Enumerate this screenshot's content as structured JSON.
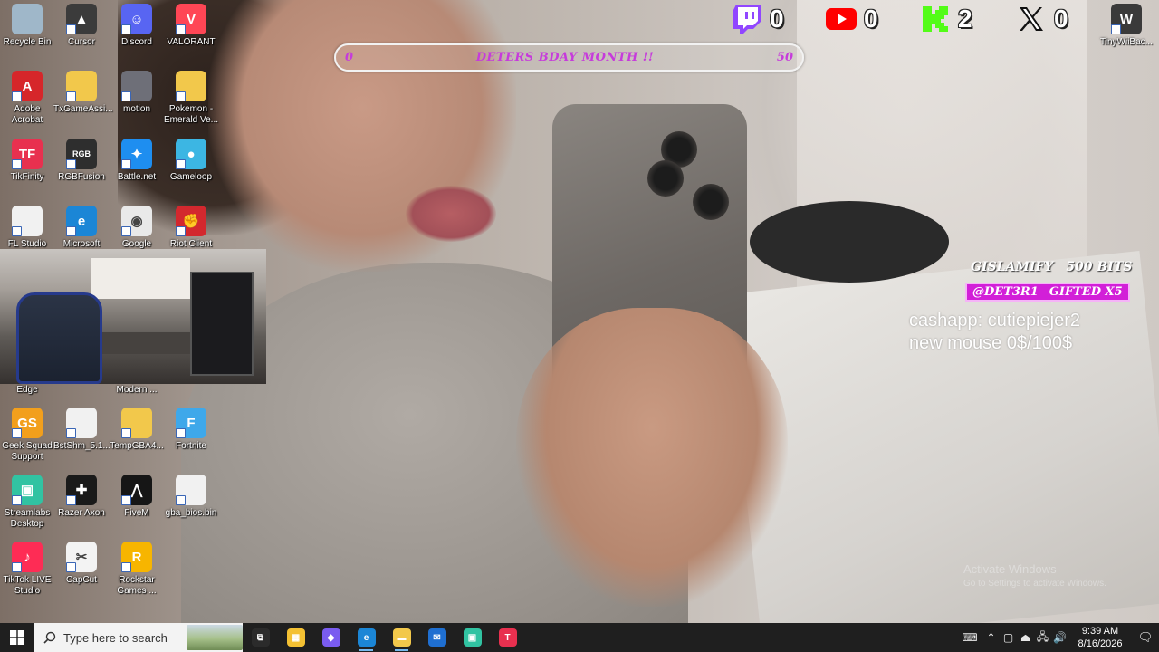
{
  "desktop_icons": [
    {
      "id": "recycle",
      "label": "Recycle Bin",
      "icon": "recycle-bin-icon",
      "color": "#9fb7c9",
      "glyph": ""
    },
    {
      "id": "cursor",
      "label": "Cursor",
      "icon": "cursor-icon",
      "color": "#3b3b3b",
      "glyph": "▲"
    },
    {
      "id": "discord",
      "label": "Discord",
      "icon": "discord-icon",
      "color": "#5865f2",
      "glyph": "☺"
    },
    {
      "id": "valorant",
      "label": "VALORANT",
      "icon": "valorant-icon",
      "color": "#ff4655",
      "glyph": "V"
    },
    {
      "id": "acrobat",
      "label": "Adobe Acrobat",
      "icon": "adobe-acrobat-icon",
      "color": "#d6262a",
      "glyph": "A"
    },
    {
      "id": "txgame",
      "label": "TxGameAssi...",
      "icon": "folder-icon",
      "color": "#f2c84b",
      "glyph": ""
    },
    {
      "id": "motion",
      "label": "motion",
      "icon": "video-file-icon",
      "color": "#6e6f78",
      "glyph": ""
    },
    {
      "id": "pokemon",
      "label": "Pokemon - Emerald Ve...",
      "icon": "folder-icon",
      "color": "#f2c84b",
      "glyph": ""
    },
    {
      "id": "tikfinity",
      "label": "TikFinity",
      "icon": "tikfinity-icon",
      "color": "#e8304f",
      "glyph": "TF"
    },
    {
      "id": "rgbfusion",
      "label": "RGBFusion",
      "icon": "rgbfusion-icon",
      "color": "#2e2e2e",
      "glyph": "RGB"
    },
    {
      "id": "battlenet",
      "label": "Battle.net",
      "icon": "battlenet-icon",
      "color": "#1e8ef0",
      "glyph": "✦"
    },
    {
      "id": "gameloop",
      "label": "Gameloop",
      "icon": "gameloop-icon",
      "color": "#3cb6e3",
      "glyph": "●"
    },
    {
      "id": "flstudio",
      "label": "FL Studio",
      "icon": "file-icon",
      "color": "#f1f1f1",
      "glyph": ""
    },
    {
      "id": "edge1",
      "label": "Microsoft",
      "icon": "edge-icon",
      "color": "#1b86d6",
      "glyph": "e"
    },
    {
      "id": "chrome",
      "label": "Google",
      "icon": "chrome-icon",
      "color": "#e9e9e9",
      "glyph": "◉"
    },
    {
      "id": "riot",
      "label": "Riot Client",
      "icon": "riot-client-icon",
      "color": "#d3282e",
      "glyph": "✊"
    },
    {
      "id": "edge2",
      "label": "Edge",
      "icon": "edge-icon",
      "color": "#1b86d6",
      "glyph": "e"
    },
    {
      "id": "modern",
      "label": "Modern ...",
      "icon": "app-icon",
      "color": "#777777",
      "glyph": ""
    },
    {
      "id": "geeksquad",
      "label": "Geek Squad Support",
      "icon": "geek-squad-icon",
      "color": "#f29f1c",
      "glyph": "GS"
    },
    {
      "id": "bstshm",
      "label": "BstShm_5.1...",
      "icon": "file-icon",
      "color": "#f1f1f1",
      "glyph": ""
    },
    {
      "id": "tempgba",
      "label": "TempGBA4...",
      "icon": "folder-icon",
      "color": "#f2c84b",
      "glyph": ""
    },
    {
      "id": "fortnite",
      "label": "Fortnite",
      "icon": "fortnite-icon",
      "color": "#3ea8ea",
      "glyph": "F"
    },
    {
      "id": "streamlabs",
      "label": "Streamlabs Desktop",
      "icon": "streamlabs-icon",
      "color": "#31c3a2",
      "glyph": "▣"
    },
    {
      "id": "razer",
      "label": "Razer Axon",
      "icon": "razer-axon-icon",
      "color": "#1a1a1a",
      "glyph": "✚"
    },
    {
      "id": "fivem",
      "label": "FiveM",
      "icon": "fivem-icon",
      "color": "#161616",
      "glyph": "⋀"
    },
    {
      "id": "gbabios",
      "label": "gba_bios.bin",
      "icon": "file-icon",
      "color": "#f1f1f1",
      "glyph": ""
    },
    {
      "id": "tiktoklive",
      "label": "TikTok LIVE Studio",
      "icon": "tiktok-live-icon",
      "color": "#fe2c55",
      "glyph": "♪"
    },
    {
      "id": "capcut",
      "label": "CapCut",
      "icon": "capcut-icon",
      "color": "#f3f3f3",
      "glyph": "✂"
    },
    {
      "id": "rockstar",
      "label": "Rockstar Games ...",
      "icon": "rockstar-icon",
      "color": "#f7b500",
      "glyph": "R"
    },
    {
      "id": "tinywii",
      "label": "TinyWiiBac...",
      "icon": "tinywii-icon",
      "color": "#3a3a3a",
      "glyph": "W"
    }
  ],
  "counters": {
    "twitch": {
      "value": "0",
      "color": "#9146ff",
      "icon": "twitch-icon"
    },
    "youtube": {
      "value": "0",
      "color": "#ff0000",
      "icon": "youtube-icon"
    },
    "kick": {
      "value": "2",
      "color": "#53fc18",
      "icon": "kick-icon"
    },
    "x": {
      "value": "0",
      "color": "#111111",
      "icon": "x-icon"
    }
  },
  "goal": {
    "start": "0",
    "title": "DETERS BDAY MONTH !!",
    "end": "50",
    "progress": 0,
    "color": "#c63bdb"
  },
  "alerts": {
    "bits_user": "GISLAMIFY",
    "bits_amount": "500 BITS",
    "gift_user": "@DET3R1",
    "gift_text": "GIFTED X5"
  },
  "info": {
    "line1": "cashapp: cutiepiejer2",
    "line2": "new mouse 0$/100$"
  },
  "watermark": {
    "title": "Activate Windows",
    "sub": "Go to Settings to activate Windows."
  },
  "taskbar": {
    "search_placeholder": "Type here to search",
    "apps": [
      {
        "id": "taskview",
        "icon": "task-view-icon",
        "color": "#2b2b2b",
        "glyph": "⧉"
      },
      {
        "id": "store",
        "icon": "microsoft-store-icon",
        "color": "#f4c133",
        "glyph": "▦"
      },
      {
        "id": "copilot",
        "icon": "copilot-icon",
        "color": "#7a5cf0",
        "glyph": "◆"
      },
      {
        "id": "edge",
        "icon": "edge-icon",
        "color": "#1b86d6",
        "glyph": "e",
        "active": true
      },
      {
        "id": "explorer",
        "icon": "file-explorer-icon",
        "color": "#f2c84b",
        "glyph": "▬",
        "active": true
      },
      {
        "id": "outlook",
        "icon": "mail-icon",
        "color": "#1f6fd1",
        "glyph": "✉"
      },
      {
        "id": "streamlabs",
        "icon": "streamlabs-icon",
        "color": "#31c3a2",
        "glyph": "▣"
      },
      {
        "id": "tikfinity",
        "icon": "tikfinity-icon",
        "color": "#e8304f",
        "glyph": "T"
      }
    ],
    "time": "9:39 AM",
    "date": "8/16/2026"
  }
}
